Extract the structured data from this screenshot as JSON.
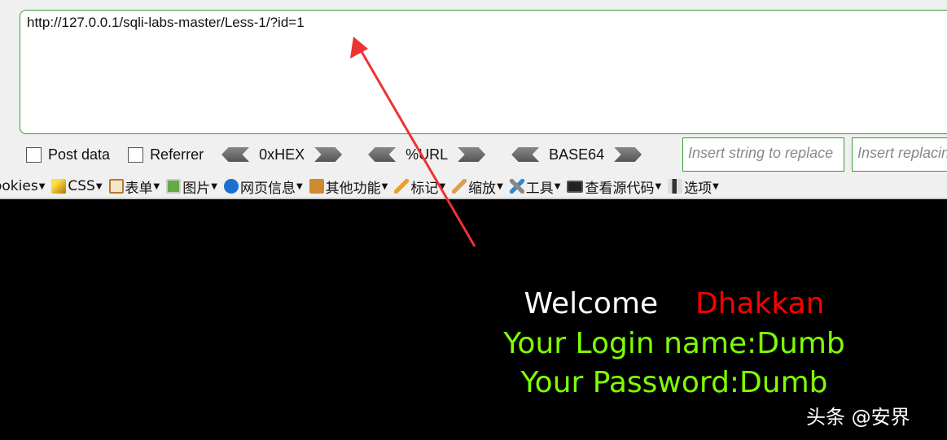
{
  "url_input": {
    "value": "http://127.0.0.1/sqli-labs-master/Less-1/?id=1"
  },
  "options": {
    "post_data": "Post data",
    "referrer": "Referrer"
  },
  "encoders": [
    "0xHEX",
    "%URL",
    "BASE64"
  ],
  "replace": {
    "find_placeholder": "Insert string to replace",
    "replace_placeholder": "Insert replacing string"
  },
  "menu": [
    "ookies",
    "CSS",
    "表单",
    "图片",
    "网页信息",
    "其他功能",
    "标记",
    "缩放",
    "工具",
    "查看源代码",
    "选项"
  ],
  "page": {
    "welcome": "Welcome",
    "name": "Dhakkan",
    "login": "Your Login name:Dumb",
    "password": "Your Password:Dumb"
  },
  "watermark": "头条 @安界",
  "colors": {
    "accent_green": "#3a9a3a",
    "welcome": "#ffffff",
    "name": "#ff0000",
    "login": "#7fff00",
    "arrow": "#ee3333"
  }
}
